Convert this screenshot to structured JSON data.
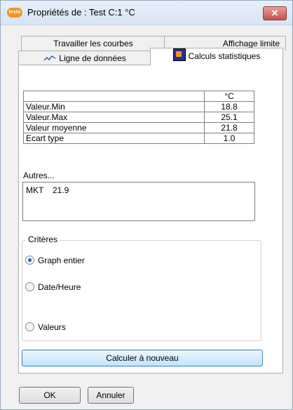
{
  "window": {
    "title": "Propriétés de : Test C:1 °C",
    "app_icon_text": "testo",
    "close_label": "✕"
  },
  "tabs": {
    "back": [
      {
        "label": "Travailler les courbes"
      },
      {
        "label": "Affichage limite"
      }
    ],
    "front": [
      {
        "label": "Ligne de données",
        "icon": "line-chart-icon"
      },
      {
        "label": "Calculs statistiques",
        "icon": "statistics-icon"
      }
    ]
  },
  "stats": {
    "unit": "°C",
    "rows": [
      {
        "label": "Valeur.Min",
        "value": "18.8"
      },
      {
        "label": "Valeur.Max",
        "value": "25.1"
      },
      {
        "label": "Valeur moyenne",
        "value": "21.8"
      },
      {
        "label": "Ecart type",
        "value": "1.0"
      }
    ]
  },
  "others": {
    "label": "Autres...",
    "name": "MKT",
    "value": "21.9"
  },
  "criteria": {
    "label": "Critères",
    "options": [
      {
        "label": "Graph entier",
        "selected": true
      },
      {
        "label": "Date/Heure",
        "selected": false
      },
      {
        "label": "Valeurs",
        "selected": false
      }
    ]
  },
  "buttons": {
    "recalculate": "Calculer à nouveau",
    "ok": "OK",
    "cancel": "Annuler"
  }
}
